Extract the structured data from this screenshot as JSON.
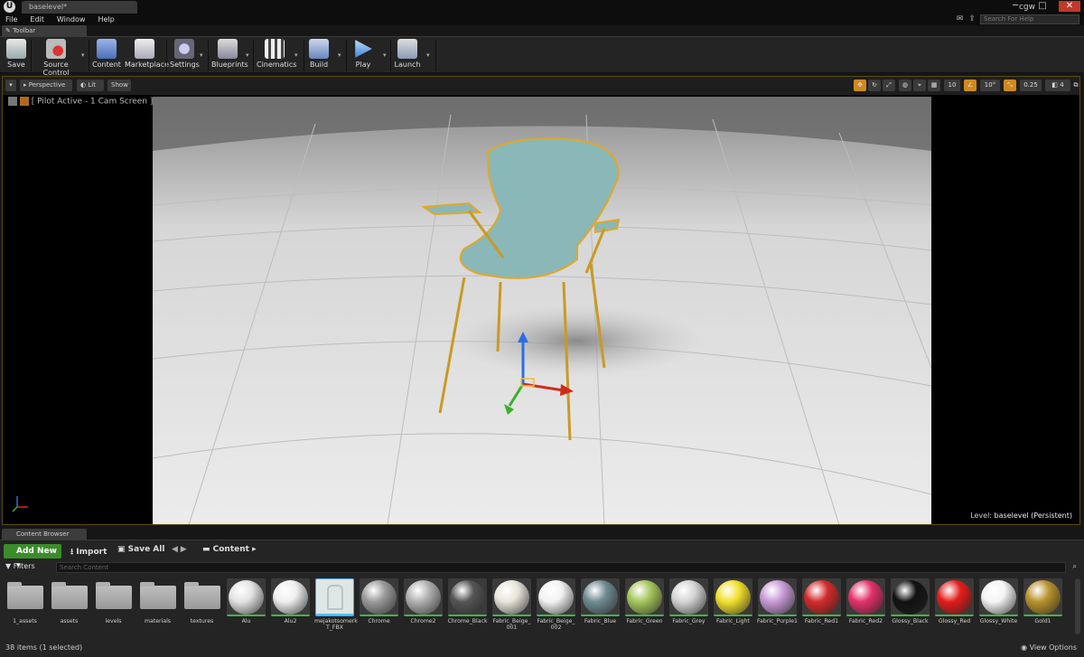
{
  "window": {
    "level_tab": "baselevel*",
    "user": "cgw",
    "search_help_placeholder": "Search For Help",
    "controls": [
      "─",
      "□",
      "✕"
    ]
  },
  "menu": [
    "File",
    "Edit",
    "Window",
    "Help"
  ],
  "toolbar": {
    "tab_label": "Toolbar",
    "buttons": [
      {
        "label": "Save",
        "icon": "save-icon"
      },
      {
        "label": "Source Control",
        "icon": "source-control-icon"
      },
      {
        "label": "Content",
        "icon": "content-icon"
      },
      {
        "label": "Marketplace",
        "icon": "marketplace-icon"
      },
      {
        "label": "Settings",
        "icon": "settings-icon"
      },
      {
        "label": "Blueprints",
        "icon": "blueprints-icon"
      },
      {
        "label": "Cinematics",
        "icon": "cinematics-icon"
      },
      {
        "label": "Build",
        "icon": "build-icon"
      },
      {
        "label": "Play",
        "icon": "play-icon"
      },
      {
        "label": "Launch",
        "icon": "launch-icon"
      }
    ]
  },
  "viewport": {
    "perspective": "Perspective",
    "lit": "Lit",
    "show": "Show",
    "pilot_label": "[ Pilot Active - 1 Cam Screen ]",
    "grid_snap": "10",
    "rotation_snap": "10°",
    "scale_snap": "0.25",
    "camera_speed": "4",
    "level_prefix": "Level:",
    "level_name": "baselevel (Persistent)"
  },
  "content_browser": {
    "tab_label": "Content Browser",
    "add_new": "Add New",
    "import": "Import",
    "save_all": "Save All",
    "path": "Content",
    "filters": "Filters",
    "search_placeholder": "Search Content",
    "status": "38 items (1 selected)",
    "view_options": "View Options",
    "assets": [
      {
        "name": "1_assets",
        "kind": "folder"
      },
      {
        "name": "assets",
        "kind": "folder"
      },
      {
        "name": "levels",
        "kind": "folder"
      },
      {
        "name": "materials",
        "kind": "folder"
      },
      {
        "name": "textures",
        "kind": "folder"
      },
      {
        "name": "Alu",
        "kind": "material",
        "color": "#e2e2e2"
      },
      {
        "name": "Alu2",
        "kind": "material",
        "color": "#eeeeee"
      },
      {
        "name": "mejakotsomerk T_FBX",
        "kind": "mesh",
        "color": "#b8c4c4"
      },
      {
        "name": "Chrome",
        "kind": "material",
        "color": "#9a9a9a"
      },
      {
        "name": "Chrome2",
        "kind": "material",
        "color": "#b0b0b0"
      },
      {
        "name": "Chrome_Black",
        "kind": "material",
        "color": "#555555"
      },
      {
        "name": "Fabric_Beige_ 001",
        "kind": "material",
        "color": "#e8e4da"
      },
      {
        "name": "Fabric_Beige_ 002",
        "kind": "material",
        "color": "#f2f2f2"
      },
      {
        "name": "Fabric_Blue",
        "kind": "material",
        "color": "#6f8a92"
      },
      {
        "name": "Fabric_Green",
        "kind": "material",
        "color": "#a4c65a"
      },
      {
        "name": "Fabric_Grey",
        "kind": "material",
        "color": "#d4d4d4"
      },
      {
        "name": "Fabric_Light",
        "kind": "material",
        "color": "#f2e02c"
      },
      {
        "name": "Fabric_Purple1",
        "kind": "material",
        "color": "#c89ad6"
      },
      {
        "name": "Fabric_Red1",
        "kind": "material",
        "color": "#d42a2a"
      },
      {
        "name": "Fabric_Red2",
        "kind": "material",
        "color": "#e2306a"
      },
      {
        "name": "Glossy_Black",
        "kind": "material",
        "color": "#111111"
      },
      {
        "name": "Glossy_Red",
        "kind": "material",
        "color": "#e41c1c"
      },
      {
        "name": "Glossy_White",
        "kind": "material",
        "color": "#f4f4f4"
      },
      {
        "name": "Gold1",
        "kind": "material",
        "color": "#b8922c"
      }
    ]
  }
}
